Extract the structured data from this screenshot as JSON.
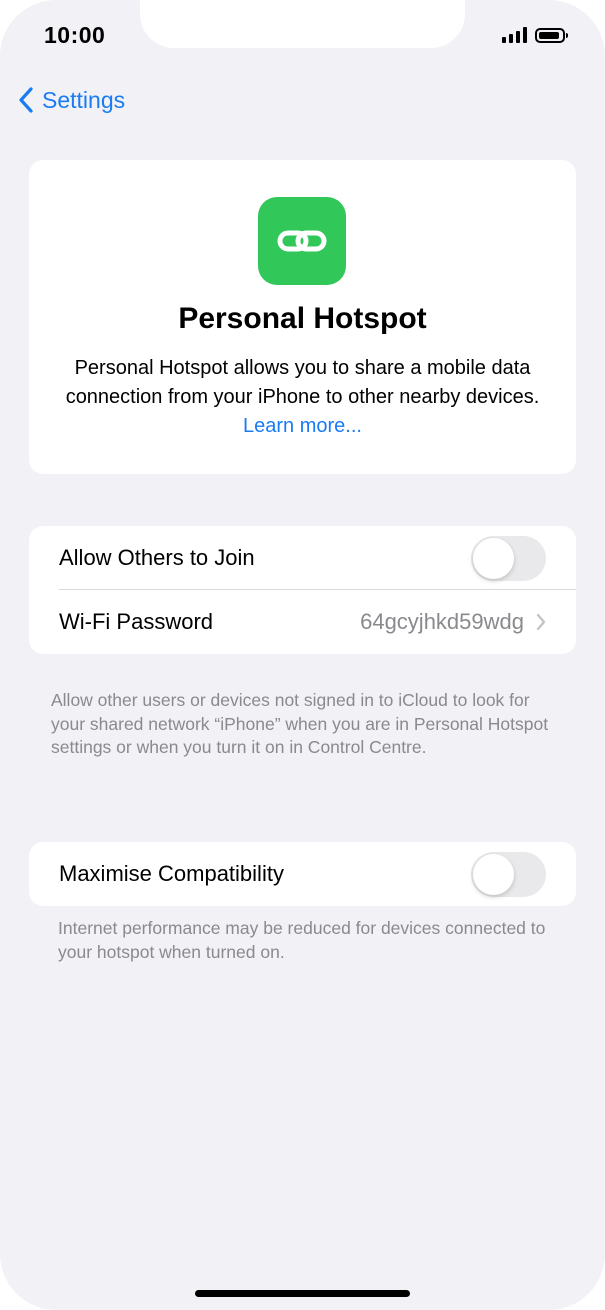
{
  "status_bar": {
    "time": "10:00",
    "battery_level_percent": 90
  },
  "nav": {
    "back_label": "Settings",
    "back_icon": "chevron-left-icon"
  },
  "hero": {
    "icon": "link-icon",
    "icon_color": "#31c759",
    "title": "Personal Hotspot",
    "description": "Personal Hotspot allows you to share a mobile data connection from your iPhone to other nearby devices.",
    "link_text": "Learn more..."
  },
  "settings": {
    "allow_others": {
      "label": "Allow Others to Join",
      "enabled": false
    },
    "wifi_password": {
      "label": "Wi-Fi Password",
      "value": "64gcyjhkd59wdg"
    },
    "allow_footnote": "Allow other users or devices not signed in to iCloud to look for your shared network “iPhone” when you are in Personal Hotspot settings or when you turn it on in Control Centre.",
    "maximise": {
      "label": "Maximise Compatibility",
      "enabled": false
    },
    "maximise_footnote": "Internet performance may be reduced for devices connected to your hotspot when turned on."
  },
  "colors": {
    "accent": "#1a7cf3",
    "background": "#f2f1f6",
    "toggle_off": "#e9e9eb"
  }
}
